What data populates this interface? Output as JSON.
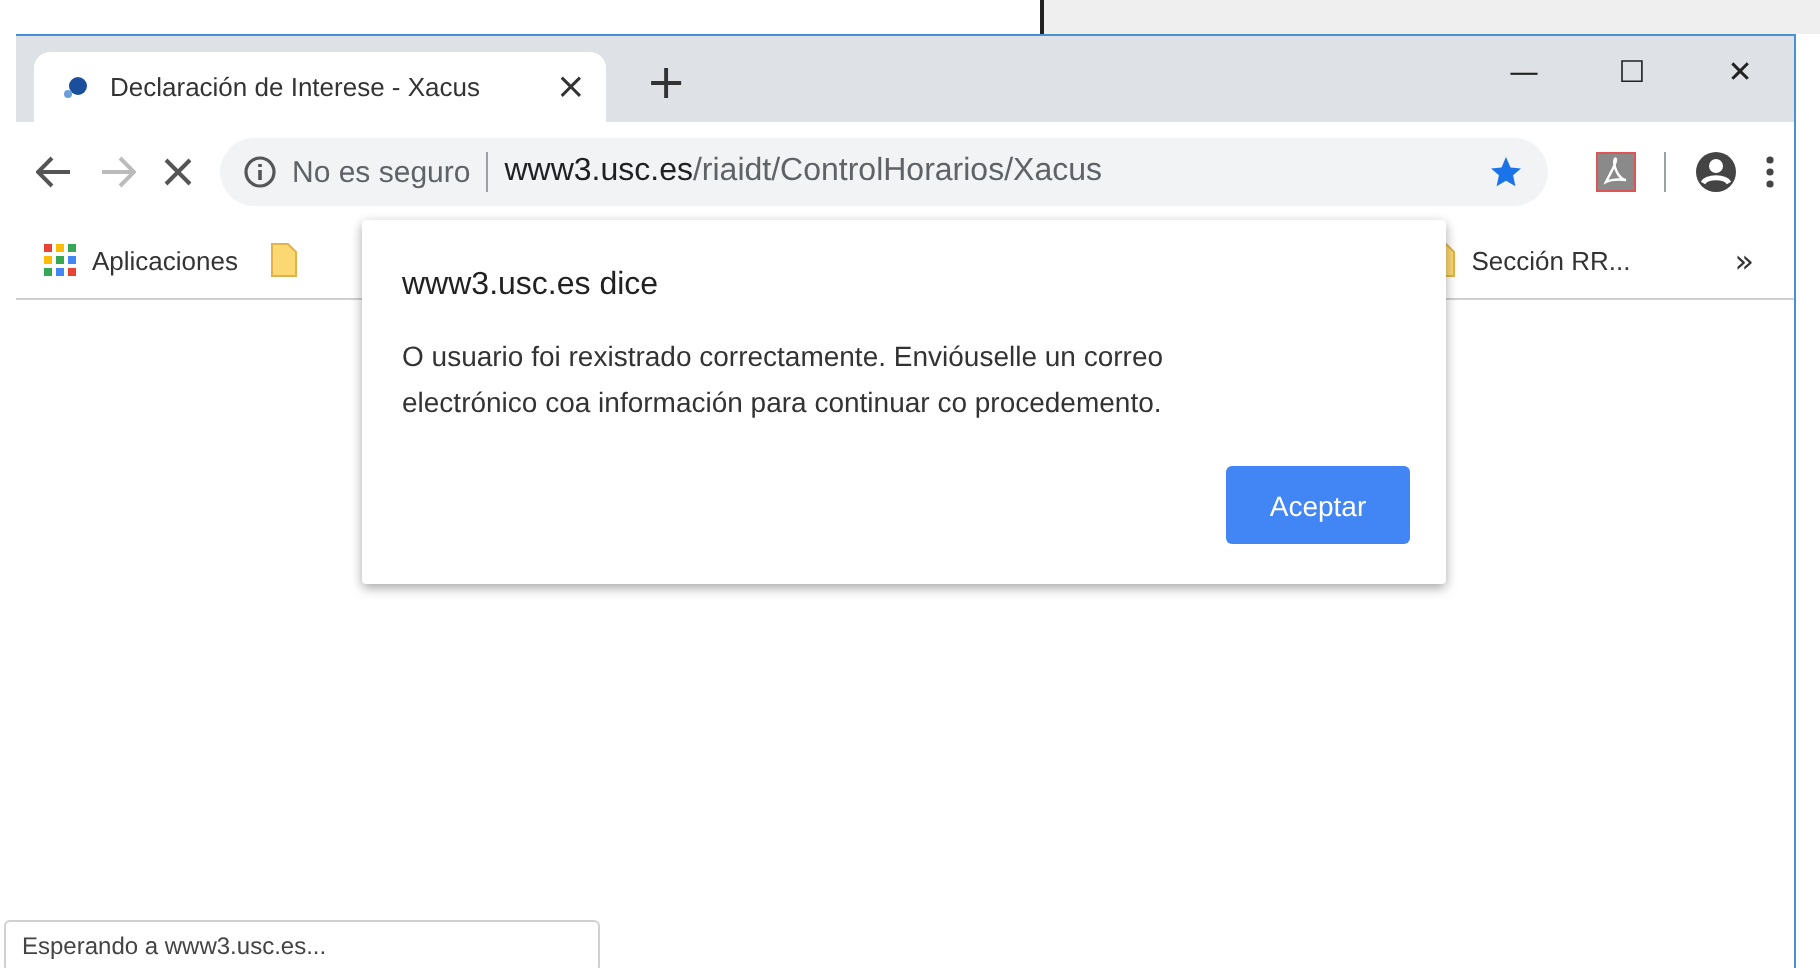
{
  "tab": {
    "title": "Declaración de Interese - Xacus",
    "close": "×",
    "new_tab": "+"
  },
  "window_controls": {
    "minimize": "—",
    "maximize": "☐",
    "close": "✕"
  },
  "address_bar": {
    "security_label": "No es seguro",
    "url_host": "www3.usc.es",
    "url_path": "/riaidt/ControlHorarios/Xacus",
    "bookmarked": true
  },
  "bookmarks": {
    "items": [
      {
        "kind": "apps",
        "label": "Aplicaciones"
      },
      {
        "kind": "folder"
      },
      {
        "kind": "folder",
        "label": "Sección RR..."
      }
    ],
    "more": "»"
  },
  "dialog": {
    "title": "www3.usc.es dice",
    "message": "O usuario foi rexistrado correctamente. Envióuselle un correo electrónico coa información para continuar co procedemento.",
    "button": "Aceptar"
  },
  "status_bubble": "Esperando a www3.usc.es..."
}
